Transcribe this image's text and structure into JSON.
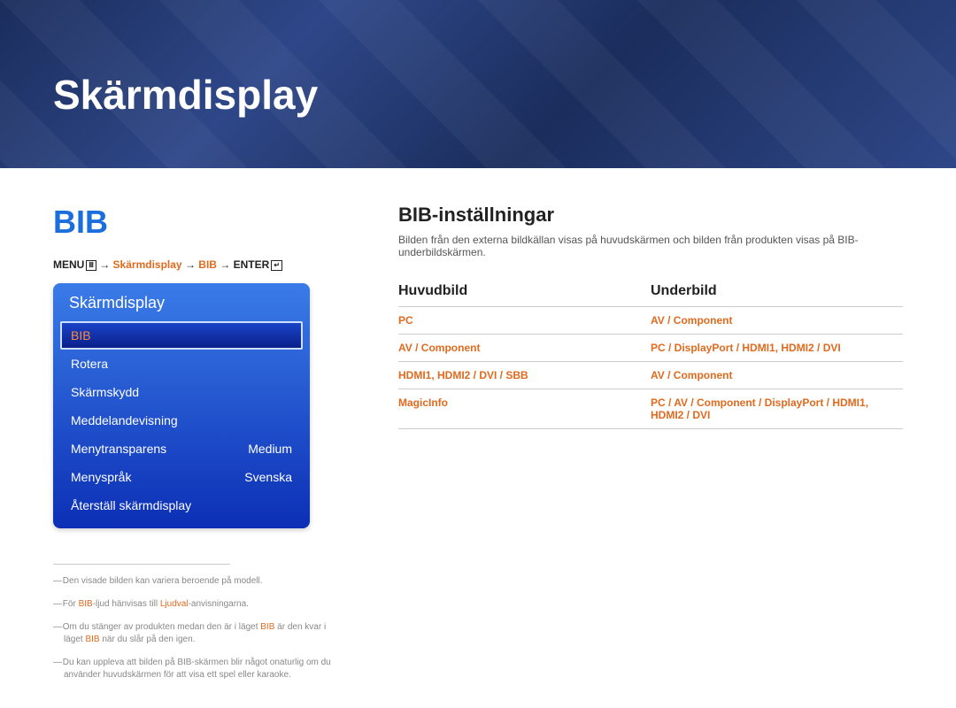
{
  "banner": {
    "title": "Skärmdisplay"
  },
  "left": {
    "section_title": "BIB",
    "breadcrumb": {
      "menu": "MENU",
      "arrow": " → ",
      "path1": "Skärmdisplay",
      "path2": "BIB",
      "enter": "ENTER"
    },
    "menu": {
      "header": "Skärmdisplay",
      "items": [
        {
          "label": "BIB",
          "value": "",
          "selected": true
        },
        {
          "label": "Rotera",
          "value": ""
        },
        {
          "label": "Skärmskydd",
          "value": ""
        },
        {
          "label": "Meddelandevisning",
          "value": ""
        },
        {
          "label": "Menytransparens",
          "value": "Medium"
        },
        {
          "label": "Menyspråk",
          "value": "Svenska"
        },
        {
          "label": "Återställ skärmdisplay",
          "value": ""
        }
      ]
    },
    "footnotes": {
      "n1": "Den visade bilden kan variera beroende på modell.",
      "n2_a": "För ",
      "n2_b": "BIB",
      "n2_c": "-ljud hänvisas till ",
      "n2_d": "Ljudval",
      "n2_e": "-anvisningarna.",
      "n3_a": "Om du stänger av produkten medan den är i läget ",
      "n3_b": "BIB",
      "n3_c": " är den kvar i läget ",
      "n3_d": "BIB",
      "n3_e": " när du slår på den igen.",
      "n4": "Du kan uppleva att bilden på BIB-skärmen blir något onaturlig om du använder huvudskärmen för att visa ett spel eller karaoke."
    }
  },
  "right": {
    "heading": "BIB-inställningar",
    "desc": "Bilden från den externa bildkällan visas på huvudskärmen och bilden från produkten visas på BIB-underbildskärmen.",
    "table": {
      "col1": "Huvudbild",
      "col2": "Underbild",
      "rows": [
        {
          "a": "PC",
          "b": "AV / Component"
        },
        {
          "a": "AV / Component",
          "b": "PC / DisplayPort / HDMI1, HDMI2 / DVI"
        },
        {
          "a": "HDMI1, HDMI2 / DVI / SBB",
          "b": "AV / Component"
        },
        {
          "a": "MagicInfo",
          "b": "PC / AV / Component / DisplayPort / HDMI1, HDMI2 / DVI"
        }
      ]
    }
  }
}
